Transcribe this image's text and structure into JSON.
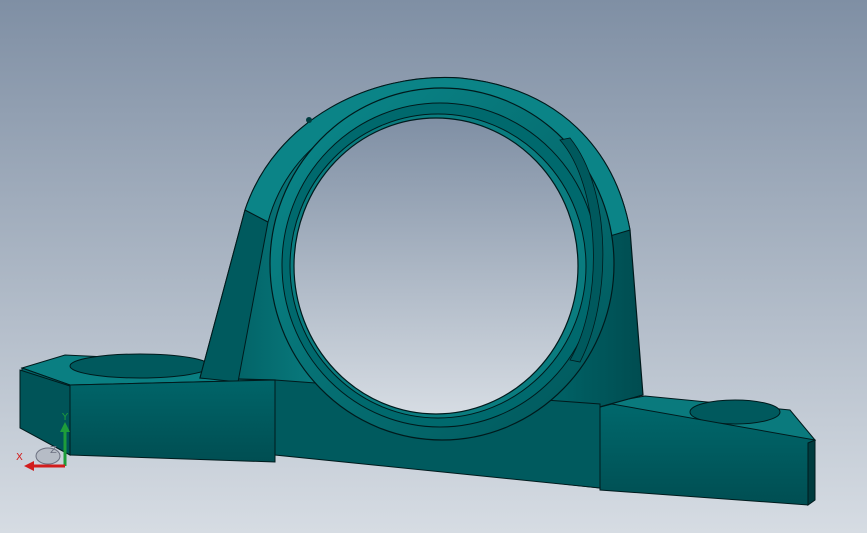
{
  "viewport": {
    "background_top": "#7f8fa4",
    "background_bottom": "#d6dce3",
    "model_color": "#00666b",
    "model_highlight": "#0b8a8d",
    "model_shadow": "#003c3f",
    "edge_color": "#001a1c"
  },
  "triad": {
    "x_label": "X",
    "y_label": "Y",
    "z_label": "Z",
    "x_color": "#d21d1d",
    "y_color": "#1e9d3a",
    "z_color": "#6b7080"
  }
}
